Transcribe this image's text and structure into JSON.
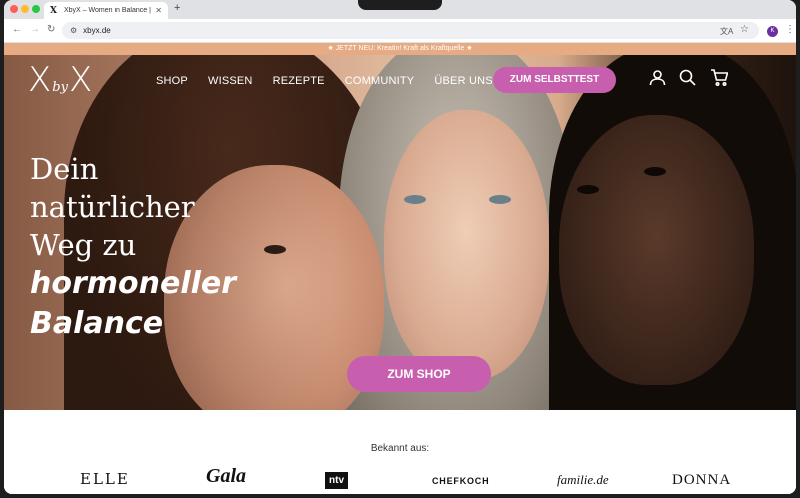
{
  "browser": {
    "tab_title": "XbyX – Women in Balance | H",
    "tab_favicon": "X",
    "url": "xbyx.de",
    "profile_initial": "K",
    "icons": [
      "back-icon",
      "forward-icon",
      "reload-icon",
      "site-info-icon",
      "translate-icon",
      "bookmark-star-icon",
      "menu-icon"
    ]
  },
  "announcement": "★ JETZT NEU: Kreatin! Kraft als Kraftquelle ★",
  "header": {
    "logo": {
      "x1": "X",
      "by": "by",
      "x2": "X"
    },
    "nav": [
      "SHOP",
      "WISSEN",
      "REZEPTE",
      "COMMUNITY",
      "ÜBER UNS"
    ],
    "cta": "ZUM SELBSTTEST",
    "icons": [
      "user-icon",
      "search-icon",
      "cart-icon"
    ]
  },
  "hero": {
    "headline": [
      "Dein",
      "natürlicher",
      "Weg zu"
    ],
    "headline_script": [
      "hormoneller",
      "Balance"
    ],
    "cta": "ZUM SHOP"
  },
  "press": {
    "label": "Bekannt aus:",
    "logos": [
      "ELLE",
      "Gala",
      "ntv",
      "CHEFKOCH",
      "familie.de",
      "DONNA"
    ]
  },
  "colors": {
    "accent": "#c85fae",
    "announcement_bar": "#e7ab83"
  }
}
